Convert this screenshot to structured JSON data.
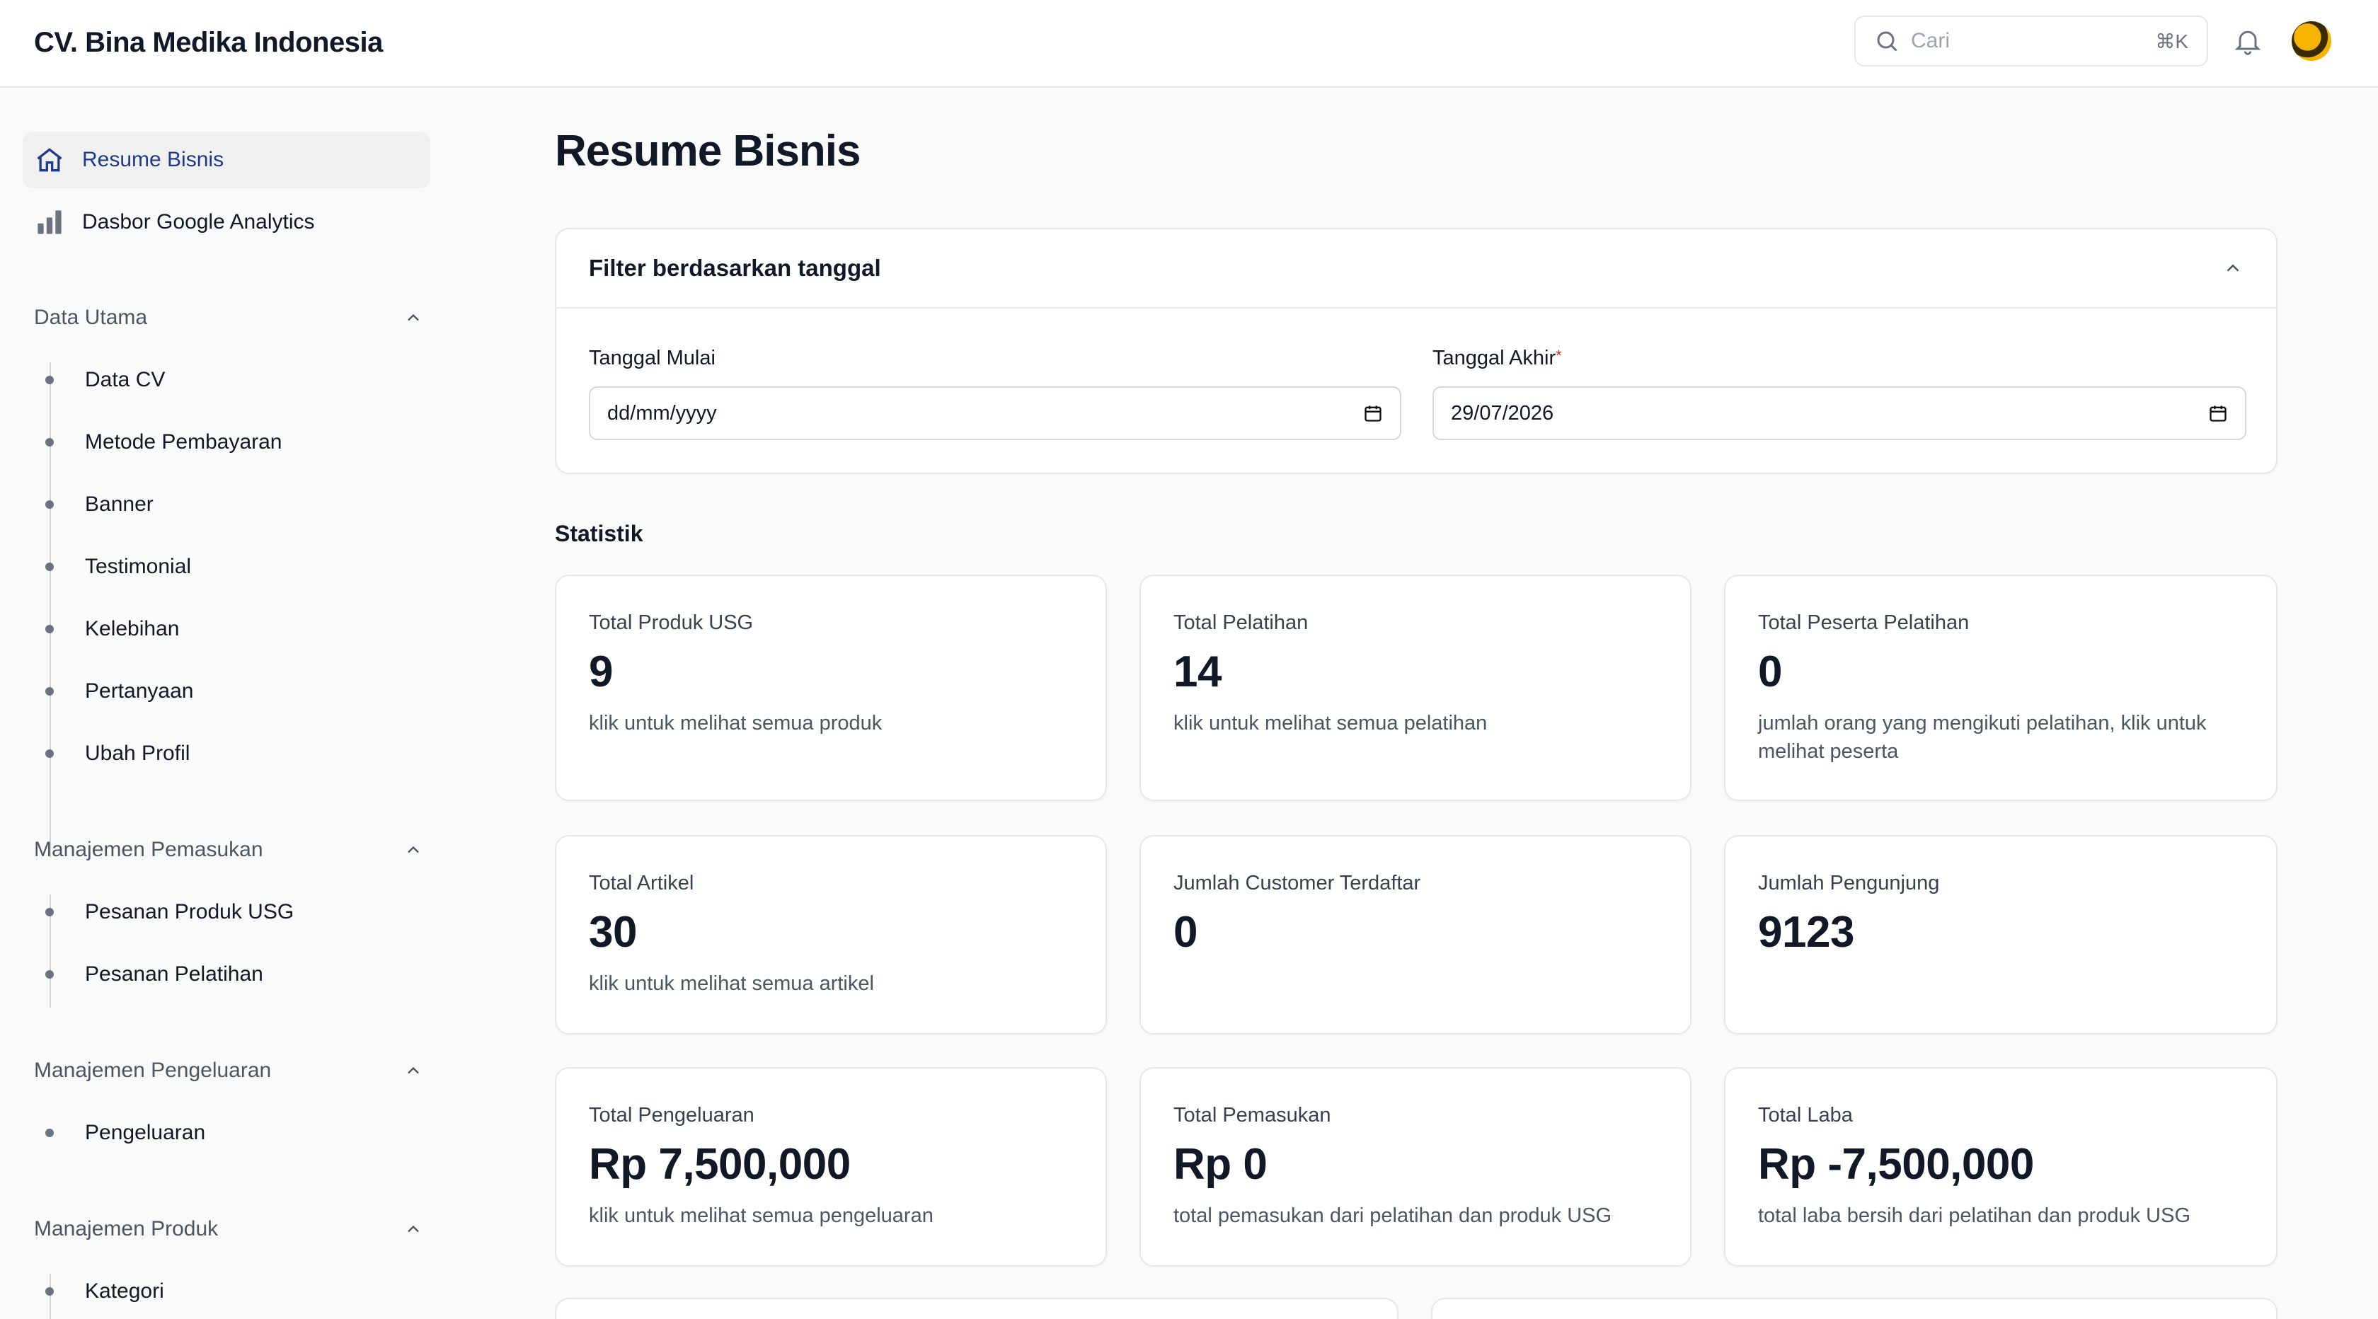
{
  "header": {
    "brand": "CV. Bina Medika Indonesia",
    "search_placeholder": "Cari",
    "search_shortcut": "⌘K"
  },
  "sidebar": {
    "top_items": [
      {
        "label": "Resume Bisnis",
        "icon": "home-icon",
        "active": true
      },
      {
        "label": "Dasbor Google Analytics",
        "icon": "bar-chart-icon",
        "active": false
      }
    ],
    "groups": [
      {
        "title": "Data Utama",
        "items": [
          "Data CV",
          "Metode Pembayaran",
          "Banner",
          "Testimonial",
          "Kelebihan",
          "Pertanyaan",
          "Ubah Profil"
        ]
      },
      {
        "title": "Manajemen Pemasukan",
        "items": [
          "Pesanan Produk USG",
          "Pesanan Pelatihan"
        ]
      },
      {
        "title": "Manajemen Pengeluaran",
        "items": [
          "Pengeluaran"
        ]
      },
      {
        "title": "Manajemen Produk",
        "items": [
          "Kategori"
        ]
      }
    ]
  },
  "main": {
    "title": "Resume Bisnis",
    "filter": {
      "title": "Filter berdasarkan tanggal",
      "start_label": "Tanggal Mulai",
      "start_value": "dd/mm/yyyy",
      "end_label": "Tanggal Akhir",
      "end_required": "*",
      "end_value": "29/07/2026"
    },
    "stats_title": "Statistik",
    "stats": [
      {
        "label": "Total Produk USG",
        "value": "9",
        "desc": "klik untuk melihat semua produk"
      },
      {
        "label": "Total Pelatihan",
        "value": "14",
        "desc": "klik untuk melihat semua pelatihan"
      },
      {
        "label": "Total Peserta Pelatihan",
        "value": "0",
        "desc": "jumlah orang yang mengikuti pelatihan, klik untuk melihat peserta"
      },
      {
        "label": "Total Artikel",
        "value": "30",
        "desc": "klik untuk melihat semua artikel"
      },
      {
        "label": "Jumlah Customer Terdaftar",
        "value": "0",
        "desc": ""
      },
      {
        "label": "Jumlah Pengunjung",
        "value": "9123",
        "desc": ""
      },
      {
        "label": "Total Pengeluaran",
        "value": "Rp 7,500,000",
        "desc": "klik untuk melihat semua pengeluaran"
      },
      {
        "label": "Total Pemasukan",
        "value": "Rp 0",
        "desc": "total pemasukan dari pelatihan dan produk USG"
      },
      {
        "label": "Total Laba",
        "value": "Rp -7,500,000",
        "desc": "total laba bersih dari pelatihan dan produk USG"
      }
    ]
  },
  "colors": {
    "accent": "#1e3a8a",
    "border": "#e5e7eb",
    "required": "#dc2626"
  }
}
